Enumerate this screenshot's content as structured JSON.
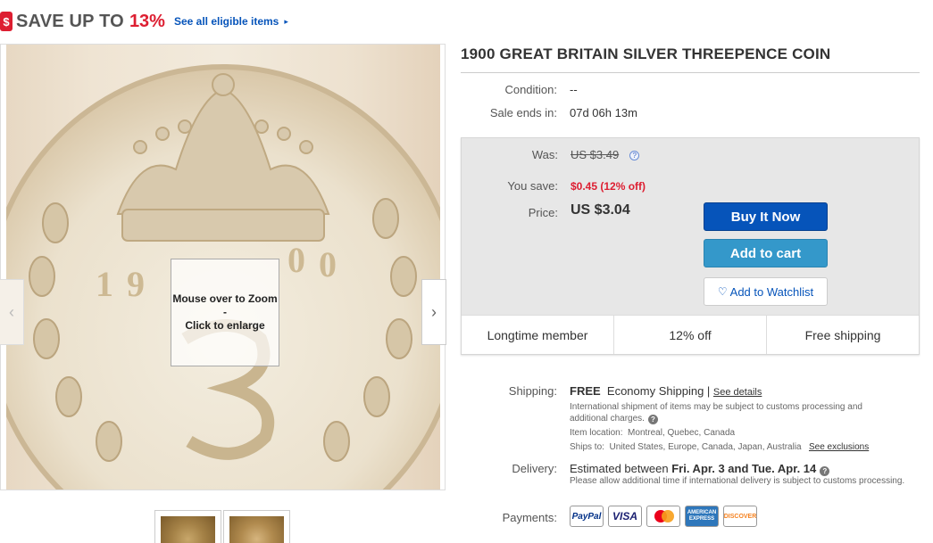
{
  "promo": {
    "tag": "$",
    "text": "SAVE UP TO",
    "percent": "13%",
    "link": "See all eligible items",
    "arrow": "▸"
  },
  "gallery": {
    "zoom_line1": "Mouse over to Zoom",
    "zoom_line2": "-",
    "zoom_line3": "Click to enlarge",
    "prev_icon": "chevron-left-icon",
    "next_icon": "chevron-right-icon",
    "prev_glyph": "‹",
    "next_glyph": "›",
    "thumbnails": 2
  },
  "item": {
    "title": "1900 GREAT BRITAIN SILVER THREEPENCE COIN",
    "condition_label": "Condition:",
    "condition_value": "--",
    "sale_ends_label": "Sale ends in:",
    "sale_ends_value": "07d 06h 13m"
  },
  "buybox": {
    "was_label": "Was:",
    "was_value": "US $3.49",
    "help_glyph": "?",
    "save_label": "You save:",
    "save_value": "$0.45 (12% off)",
    "price_label": "Price:",
    "price_value": "US $3.04",
    "buy_now": "Buy It Now",
    "add_to_cart": "Add to cart",
    "watchlist_heart": "♡",
    "add_to_watchlist": "Add to Watchlist",
    "badges": [
      "Longtime member",
      "12% off",
      "Free shipping"
    ]
  },
  "shipping": {
    "label": "Shipping:",
    "free": "FREE",
    "method": "Economy Shipping |",
    "details_link": "See details",
    "intl_note": "International shipment of items may be subject to customs processing and additional charges.",
    "help_glyph": "?",
    "location_label": "Item location:",
    "location_value": "Montreal, Quebec, Canada",
    "ships_to_label": "Ships to:",
    "ships_to_value": "United States, Europe, Canada, Japan, Australia",
    "exclusions_link": "See exclusions"
  },
  "delivery": {
    "label": "Delivery:",
    "prefix": "Estimated between",
    "dates": "Fri. Apr. 3 and Tue. Apr. 14",
    "help_glyph": "?",
    "note": "Please allow additional time if international delivery is subject to customs processing."
  },
  "payments": {
    "label": "Payments:",
    "methods": [
      "PayPal",
      "VISA",
      "MasterCard",
      "AMERICAN EXPRESS",
      "DISCOVER"
    ]
  },
  "colors": {
    "ebay_blue": "#0654ba",
    "cart_blue": "#3498ca",
    "promo_red": "#dd1e31"
  }
}
